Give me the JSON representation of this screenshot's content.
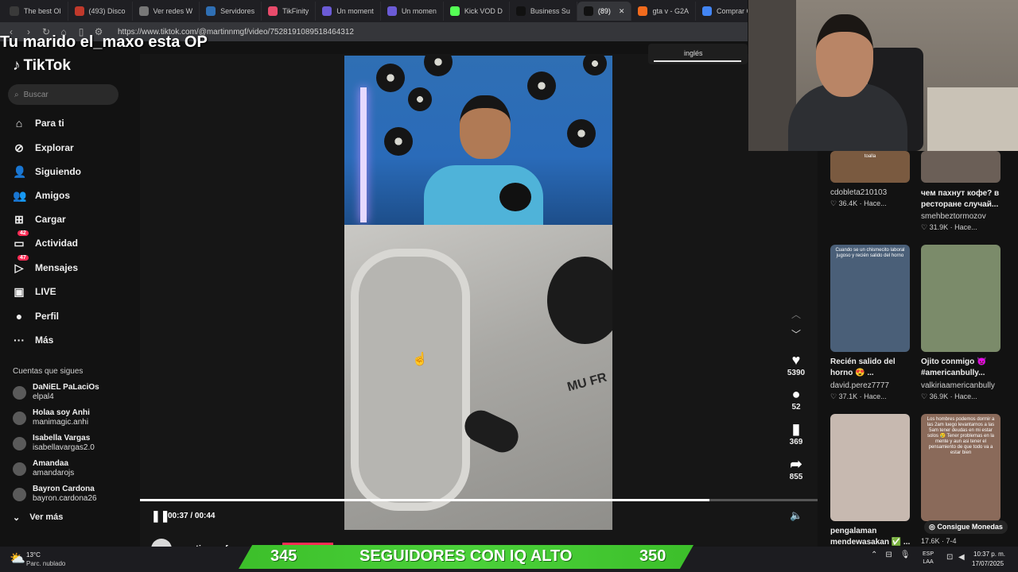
{
  "browser": {
    "tabs": [
      {
        "label": "The best Ol",
        "color": "#3a3a3a"
      },
      {
        "label": "(493) Disco",
        "color": "#c0392b"
      },
      {
        "label": "Ver redes W",
        "color": "#777777"
      },
      {
        "label": "Servidores",
        "color": "#2f6fb4"
      },
      {
        "label": "TikFinity",
        "color": "#e84b6b"
      },
      {
        "label": "Un moment",
        "color": "#6b5bd6"
      },
      {
        "label": "Un momen",
        "color": "#6b5bd6"
      },
      {
        "label": "Kick VOD D",
        "color": "#55ff55"
      },
      {
        "label": "Business Su",
        "color": "#111111"
      },
      {
        "label": "(89)",
        "color": "#111111",
        "active": true
      },
      {
        "label": "gta v - G2A",
        "color": "#f26b1d"
      },
      {
        "label": "Comprar G",
        "color": "#4285f4"
      }
    ],
    "tab_overflow": "›",
    "tab_close": "✕",
    "url": "https://www.tiktok.com/@martinnmgf/video/7528191089518464312"
  },
  "overlay_title": "Tu marido el_maxo esta OP",
  "tiktok": {
    "logo": "TikTok",
    "search_placeholder": "Buscar",
    "nav": [
      {
        "label": "Para ti",
        "icon": "home-icon",
        "glyph": "⌂"
      },
      {
        "label": "Explorar",
        "icon": "compass-icon",
        "glyph": "⊘"
      },
      {
        "label": "Siguiendo",
        "icon": "following-icon",
        "glyph": "👤"
      },
      {
        "label": "Amigos",
        "icon": "friends-icon",
        "glyph": "👥"
      },
      {
        "label": "Cargar",
        "icon": "upload-icon",
        "glyph": "⊞"
      },
      {
        "label": "Actividad",
        "icon": "activity-icon",
        "glyph": "▭",
        "badge": "42"
      },
      {
        "label": "Mensajes",
        "icon": "messages-icon",
        "glyph": "▷",
        "badge": "47"
      },
      {
        "label": "LIVE",
        "icon": "live-icon",
        "glyph": "▣"
      },
      {
        "label": "Perfil",
        "icon": "profile-avatar-icon",
        "glyph": "●"
      },
      {
        "label": "Más",
        "icon": "more-icon",
        "glyph": "···"
      }
    ],
    "following_title": "Cuentas que sigues",
    "accounts": [
      {
        "name": "DaNiEL PaLaciOs",
        "user": "elpal4"
      },
      {
        "name": "Holaa soy Anhi",
        "user": "manimagic.anhi"
      },
      {
        "name": "Isabella Vargas",
        "user": "isabellavargas2.0"
      },
      {
        "name": "Amandaa",
        "user": "amandarojs"
      },
      {
        "name": "Bayron Cardona",
        "user": "bayron.cardona26"
      }
    ],
    "see_more": "Ver más",
    "video": {
      "likes": "5390",
      "comments": "52",
      "saves": "369",
      "shares": "855",
      "time": "00:37 / 00:44",
      "progress": 0.84,
      "author": "martinnmgf",
      "overlay_text": "MU FR"
    },
    "language": "inglés",
    "feed": [
      {
        "caption": "",
        "thumb_text": "toalla",
        "author": "cdobleta210103",
        "stats": "♡ 36.4K  ·  Hace...",
        "color": "#7a5a40"
      },
      {
        "caption": "чем пахнут кофе? в ресторане случай...",
        "author": "smehbeztormozov",
        "stats": "♡ 31.9K  ·  Насе...",
        "color": "#6b5f57"
      },
      {
        "caption": "Recién salido del horno 😍 ...",
        "thumb_text": "Cuando se un chismecito laboral jugoso y recién salido del horno",
        "author": "david.perez7777",
        "stats": "♡ 37.1K  ·  Hace...",
        "color": "#4a5f78"
      },
      {
        "caption": "Ojito conmigo 👿 #americanbully...",
        "author": "valkiriaamericanbully",
        "stats": "♡ 36.9K  ·  Hace...",
        "color": "#7b8b6a"
      },
      {
        "caption": "pengalaman mendewasakan ✅ ...",
        "author": "",
        "stats": "",
        "color": "#c7b9b0"
      },
      {
        "caption": "",
        "thumb_text": "Los hombres podemos dormir a las 2am luego levantarnos a las 5am tener deudas en mi estar solos 😢 Tener problemas en la mente y aun asi tener el pensamiento de que todo va a estar bien",
        "author": "",
        "stats": "17.6K  ·  7-4",
        "color": "#8a6a5a"
      }
    ],
    "consigue": "Consigue Monedas"
  },
  "stream": {
    "left_count": "345",
    "label": "SEGUIDORES CON IQ ALTO",
    "right_count": "350"
  },
  "taskbar": {
    "temp": "13°C",
    "weather": "Parc. nublado",
    "lang1": "ESP",
    "lang2": "LAA",
    "time": "10:37 p. m.",
    "date": "17/07/2025"
  }
}
